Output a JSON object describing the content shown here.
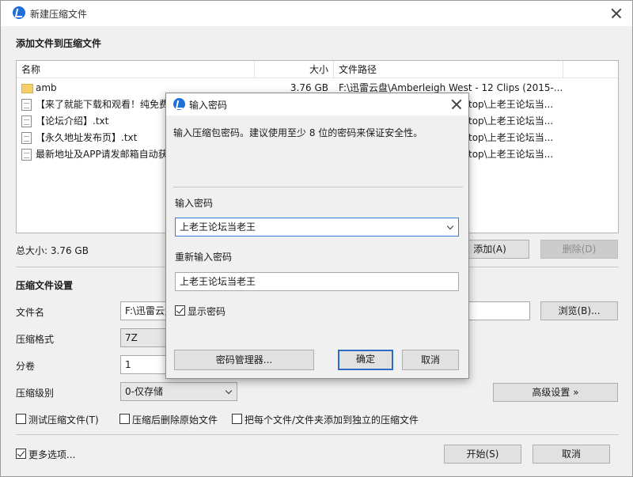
{
  "window": {
    "title": "新建压缩文件",
    "section_add_files": "添加文件到压缩文件",
    "total_size": "总大小: 3.76 GB",
    "settings_heading": "压缩文件设置"
  },
  "file_list": {
    "columns": {
      "name": "名称",
      "size": "大小",
      "path": "文件路径"
    },
    "rows": [
      {
        "icon": "folder-icon",
        "name": "amb",
        "size": "3.76 GB",
        "path": "F:\\迅雷云盘\\Amberleigh West - 12 Clips (2015-..."
      },
      {
        "icon": "file-icon",
        "name": "【来了就能下载和观看！纯免费",
        "size": "",
        "path": "top\\上老王论坛当..."
      },
      {
        "icon": "file-icon",
        "name": "【论坛介绍】.txt",
        "size": "",
        "path": "top\\上老王论坛当..."
      },
      {
        "icon": "file-icon",
        "name": "【永久地址发布页】.txt",
        "size": "",
        "path": "top\\上老王论坛当..."
      },
      {
        "icon": "file-icon",
        "name": "最新地址及APP请发邮箱自动获",
        "size": "",
        "path": "top\\上老王论坛当..."
      }
    ]
  },
  "buttons": {
    "add": "添加(A)",
    "delete": "删除(D)",
    "browse": "浏览(B)...",
    "advanced": "高级设置 »",
    "start": "开始(S)",
    "cancel": "取消"
  },
  "settings": {
    "filename_label": "文件名",
    "filename_value": "F:\\迅雷云盘",
    "format_label": "压缩格式",
    "format_value": "7Z",
    "volume_label": "分卷",
    "volume_value": "1",
    "level_label": "压缩级别",
    "level_value": "0-仅存储"
  },
  "options": {
    "test": {
      "label": "测试压缩文件(T)",
      "checked": false
    },
    "delete_original": {
      "label": "压缩后删除原始文件",
      "checked": false
    },
    "separate": {
      "label": "把每个文件/文件夹添加到独立的压缩文件",
      "checked": false
    },
    "more": {
      "label": "更多选项...",
      "checked": true
    }
  },
  "password_dialog": {
    "title": "输入密码",
    "hint": "输入压缩包密码。建议使用至少 8 位的密码来保证安全性。",
    "password_label": "输入密码",
    "password_value": "上老王论坛当老王",
    "confirm_label": "重新输入密码",
    "confirm_value": "上老王论坛当老王",
    "show_password": {
      "label": "显示密码",
      "checked": true
    },
    "manager_button": "密码管理器...",
    "ok_button": "确定",
    "cancel_button": "取消"
  },
  "colors": {
    "accent": "#1f6fd8",
    "window_bg": "#f0f0f0",
    "primary_border": "#2d6cc4"
  }
}
